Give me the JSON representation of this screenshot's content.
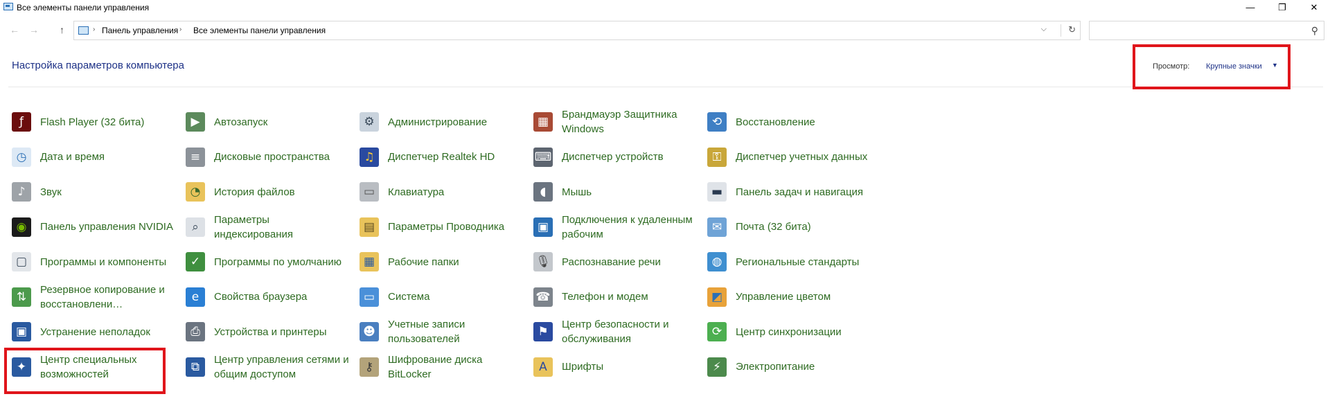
{
  "window": {
    "title": "Все элементы панели управления",
    "min": "—",
    "max": "❐",
    "close": "✕"
  },
  "addressbar": {
    "back": "←",
    "forward": "→",
    "up": "↑",
    "crumb_sep": "›",
    "breadcrumbs": [
      "Панель управления",
      "Все элементы панели управления"
    ],
    "dropdown": "⌵",
    "refresh": "↻"
  },
  "search": {
    "placeholder": "",
    "icon": "search-icon",
    "glyph": "⚲"
  },
  "header": {
    "title": "Настройка параметров компьютера",
    "view_label": "Просмотр:",
    "view_value": "Крупные значки",
    "caret": "▼"
  },
  "accent": {
    "link": "#2e6b22",
    "heading": "#1e3287",
    "highlight": "#e0151b"
  },
  "items": [
    {
      "label": "Flash Player (32 бита)",
      "icon": "flash-player-icon",
      "bg": "#6b0d0d",
      "fg": "#ffffff",
      "glyph": "ƒ"
    },
    {
      "label": "Автозапуск",
      "icon": "autoplay-icon",
      "bg": "#5c8a5c",
      "fg": "#ffffff",
      "glyph": "▶"
    },
    {
      "label": "Администрирование",
      "icon": "administrative-tools-icon",
      "bg": "#c9d3dd",
      "fg": "#3a4a5a",
      "glyph": "⚙"
    },
    {
      "label": "Брандмауэр Защитника Windows",
      "icon": "firewall-icon",
      "bg": "#a84a35",
      "fg": "#ffffff",
      "glyph": "▦"
    },
    {
      "label": "Восстановление",
      "icon": "recovery-icon",
      "bg": "#3f7fc4",
      "fg": "#ffffff",
      "glyph": "⟲"
    },
    {
      "label": "Дата и время",
      "icon": "date-time-icon",
      "bg": "#dde9f5",
      "fg": "#2a6fb5",
      "glyph": "◷"
    },
    {
      "label": "Дисковые пространства",
      "icon": "storage-spaces-icon",
      "bg": "#8c9299",
      "fg": "#ffffff",
      "glyph": "≡"
    },
    {
      "label": "Диспетчер Realtek HD",
      "icon": "realtek-icon",
      "bg": "#2a4aa0",
      "fg": "#ffcc33",
      "glyph": "♫"
    },
    {
      "label": "Диспетчер устройств",
      "icon": "device-manager-icon",
      "bg": "#5d6570",
      "fg": "#ffffff",
      "glyph": "⌨"
    },
    {
      "label": "Диспетчер учетных данных",
      "icon": "credential-manager-icon",
      "bg": "#c9a73a",
      "fg": "#ffffff",
      "glyph": "⚿"
    },
    {
      "label": "Звук",
      "icon": "sound-icon",
      "bg": "#9ea3a8",
      "fg": "#ffffff",
      "glyph": "♪"
    },
    {
      "label": "История файлов",
      "icon": "file-history-icon",
      "bg": "#e9c35b",
      "fg": "#3b6a2c",
      "glyph": "◔"
    },
    {
      "label": "Клавиатура",
      "icon": "keyboard-icon",
      "bg": "#b9bdc2",
      "fg": "#555555",
      "glyph": "▭"
    },
    {
      "label": "Мышь",
      "icon": "mouse-icon",
      "bg": "#6b7480",
      "fg": "#ffffff",
      "glyph": "◖"
    },
    {
      "label": "Панель задач и навигация",
      "icon": "taskbar-icon",
      "bg": "#dfe3e8",
      "fg": "#2a3a50",
      "glyph": "▬"
    },
    {
      "label": "Панель управления NVIDIA",
      "icon": "nvidia-icon",
      "bg": "#1b1b1b",
      "fg": "#76b900",
      "glyph": "◉"
    },
    {
      "label": "Параметры индексирования",
      "icon": "indexing-options-icon",
      "bg": "#dde1e6",
      "fg": "#3a4a5a",
      "glyph": "⌕"
    },
    {
      "label": "Параметры Проводника",
      "icon": "explorer-options-icon",
      "bg": "#e9c35b",
      "fg": "#5a4a20",
      "glyph": "▤"
    },
    {
      "label": "Подключения к удаленным рабочим",
      "icon": "remote-desktop-icon",
      "bg": "#2a6fb5",
      "fg": "#ffffff",
      "glyph": "▣"
    },
    {
      "label": "Почта (32 бита)",
      "icon": "mail-icon",
      "bg": "#6fa3d6",
      "fg": "#ffffff",
      "glyph": "✉"
    },
    {
      "label": "Программы и компоненты",
      "icon": "programs-features-icon",
      "bg": "#e3e6ea",
      "fg": "#3a4a5a",
      "glyph": "▢"
    },
    {
      "label": "Программы по умолчанию",
      "icon": "default-programs-icon",
      "bg": "#3f8f3f",
      "fg": "#ffffff",
      "glyph": "✓"
    },
    {
      "label": "Рабочие папки",
      "icon": "work-folders-icon",
      "bg": "#e9c35b",
      "fg": "#2a5aa0",
      "glyph": "▦"
    },
    {
      "label": "Распознавание речи",
      "icon": "speech-recognition-icon",
      "bg": "#c3c7cc",
      "fg": "#444444",
      "glyph": "🎙"
    },
    {
      "label": "Региональные стандарты",
      "icon": "region-icon",
      "bg": "#3f8fd0",
      "fg": "#ffffff",
      "glyph": "◍"
    },
    {
      "label": "Резервное копирование и восстановлени…",
      "icon": "backup-restore-icon",
      "bg": "#4c9a4c",
      "fg": "#ffffff",
      "glyph": "⇅"
    },
    {
      "label": "Свойства браузера",
      "icon": "internet-options-icon",
      "bg": "#2a7fd4",
      "fg": "#ffffff",
      "glyph": "e"
    },
    {
      "label": "Система",
      "icon": "system-icon",
      "bg": "#4a90d9",
      "fg": "#ffffff",
      "glyph": "▭"
    },
    {
      "label": "Телефон и модем",
      "icon": "phone-modem-icon",
      "bg": "#7d848c",
      "fg": "#ffffff",
      "glyph": "☎"
    },
    {
      "label": "Управление цветом",
      "icon": "color-management-icon",
      "bg": "#e8a23a",
      "fg": "#2a6fb5",
      "glyph": "◩"
    },
    {
      "label": "Устранение неполадок",
      "icon": "troubleshooting-icon",
      "bg": "#2a5aa0",
      "fg": "#ffffff",
      "glyph": "▣"
    },
    {
      "label": "Устройства и принтеры",
      "icon": "devices-printers-icon",
      "bg": "#6b7480",
      "fg": "#ffffff",
      "glyph": "⎙"
    },
    {
      "label": "Учетные записи пользователей",
      "icon": "user-accounts-icon",
      "bg": "#4a7fc0",
      "fg": "#ffffff",
      "glyph": "☻"
    },
    {
      "label": "Центр безопасности и обслуживания",
      "icon": "security-maintenance-icon",
      "bg": "#2a4aa0",
      "fg": "#ffffff",
      "glyph": "⚑"
    },
    {
      "label": "Центр синхронизации",
      "icon": "sync-center-icon",
      "bg": "#4caf50",
      "fg": "#ffffff",
      "glyph": "⟳"
    },
    {
      "label": "Центр специальных возможностей",
      "icon": "ease-of-access-icon",
      "bg": "#2a5aa0",
      "fg": "#ffffff",
      "glyph": "✦"
    },
    {
      "label": "Центр управления сетями и общим доступом",
      "icon": "network-sharing-icon",
      "bg": "#2a5aa0",
      "fg": "#ffffff",
      "glyph": "⧉"
    },
    {
      "label": "Шифрование диска BitLocker",
      "icon": "bitlocker-icon",
      "bg": "#b3a37a",
      "fg": "#3a3a3a",
      "glyph": "⚷"
    },
    {
      "label": "Шрифты",
      "icon": "fonts-icon",
      "bg": "#e9c35b",
      "fg": "#2a4aa0",
      "glyph": "A"
    },
    {
      "label": "Электропитание",
      "icon": "power-options-icon",
      "bg": "#4c8a4c",
      "fg": "#ffffff",
      "glyph": "⚡"
    }
  ]
}
